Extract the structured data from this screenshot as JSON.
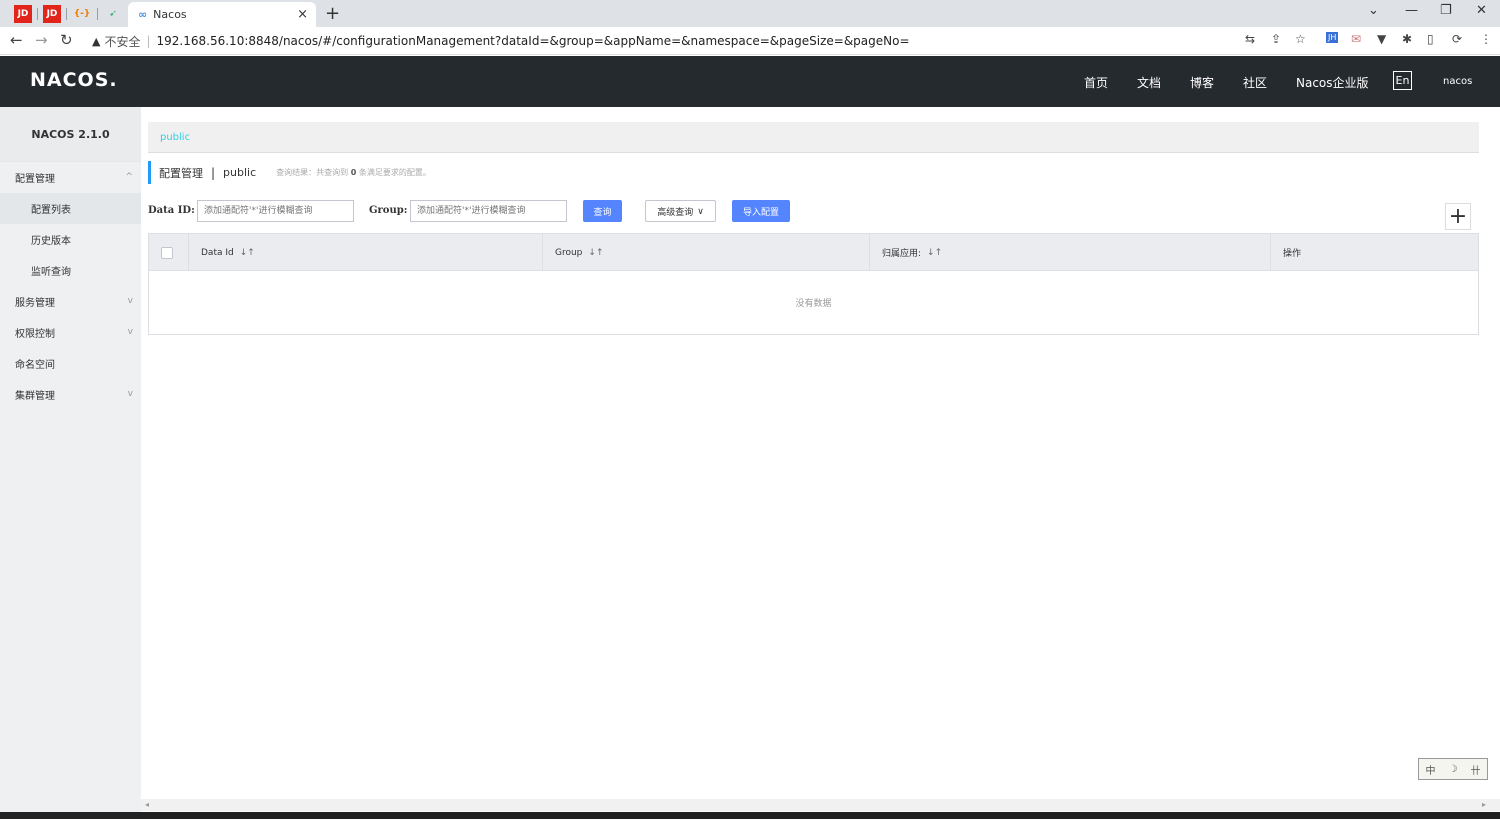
{
  "browser": {
    "pinned_tabs": [
      {
        "label": "JD",
        "color": "#e1251b"
      },
      {
        "label": "JD",
        "color": "#e1251b"
      },
      {
        "label": "{-}",
        "color": "#f57c00"
      },
      {
        "label": "➹",
        "color": "#3cb371"
      }
    ],
    "tab": {
      "icon": "∞",
      "title": "Nacos",
      "close": "×"
    },
    "new_tab": "+",
    "window_controls": [
      "⌄",
      "—",
      "❐",
      "✕"
    ],
    "nav": {
      "back": "←",
      "forward": "→",
      "reload": "↻"
    },
    "security": {
      "icon": "▲",
      "text": "不安全"
    },
    "url": "192.168.56.10:8848/nacos/#/configurationManagement?dataId=&group=&appName=&namespace=&pageSize=&pageNo=",
    "extensions": [
      "⇆",
      "⇪",
      "☆",
      "JH",
      "✉",
      "▼",
      "✱",
      "▯",
      "⟳",
      "⋮"
    ]
  },
  "header": {
    "logo": "NACOS.",
    "nav": [
      "首页",
      "文档",
      "博客",
      "社区",
      "Nacos企业版"
    ],
    "lang": "En",
    "user": "nacos"
  },
  "sidebar": {
    "version": "NACOS 2.1.0",
    "items": [
      {
        "label": "配置管理",
        "chevron": "^",
        "sub": false,
        "active": false
      },
      {
        "label": "配置列表",
        "chevron": "",
        "sub": true,
        "active": true
      },
      {
        "label": "历史版本",
        "chevron": "",
        "sub": true,
        "active": false
      },
      {
        "label": "监听查询",
        "chevron": "",
        "sub": true,
        "active": false
      },
      {
        "label": "服务管理",
        "chevron": "v",
        "sub": false,
        "active": false
      },
      {
        "label": "权限控制",
        "chevron": "v",
        "sub": false,
        "active": false
      },
      {
        "label": "命名空间",
        "chevron": "",
        "sub": false,
        "active": false
      },
      {
        "label": "集群管理",
        "chevron": "v",
        "sub": false,
        "active": false
      }
    ]
  },
  "main": {
    "namespace_link": "public",
    "title": "配置管理",
    "title_sep": "|",
    "title_namespace": "public",
    "result_prefix": "查询结果：共查询到",
    "result_count": "0",
    "result_suffix": "条满足要求的配置。",
    "filter": {
      "data_id_label": "Data ID:",
      "data_id_placeholder": "添加通配符'*'进行模糊查询",
      "group_label": "Group:",
      "group_placeholder": "添加通配符'*'进行模糊查询",
      "query_button": "查询",
      "advanced_button": "高级查询",
      "import_button": "导入配置"
    },
    "add_button": "+",
    "table": {
      "columns": [
        "Data Id",
        "Group",
        "归属应用:",
        "操作"
      ],
      "sort_icon": "↓↑",
      "empty": "没有数据"
    }
  },
  "ime": [
    "中",
    "☽",
    "卄"
  ]
}
